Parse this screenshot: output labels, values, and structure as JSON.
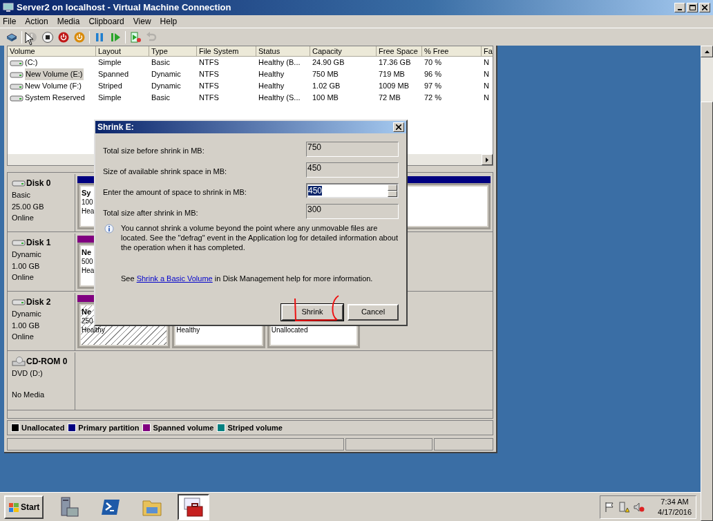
{
  "window": {
    "title": "Server2 on localhost - Virtual Machine Connection"
  },
  "menu": [
    "File",
    "Action",
    "Media",
    "Clipboard",
    "View",
    "Help"
  ],
  "toolbar": [
    {
      "kind": "keys",
      "disabled": false
    },
    {
      "kind": "start",
      "disabled": true
    },
    {
      "kind": "stop",
      "disabled": false
    },
    {
      "kind": "shutdown",
      "disabled": false
    },
    {
      "kind": "save",
      "disabled": false
    },
    {
      "kind": "pause",
      "disabled": false
    },
    {
      "kind": "reset",
      "disabled": false
    },
    {
      "kind": "checkpoint",
      "disabled": false
    },
    {
      "kind": "revert",
      "disabled": true
    }
  ],
  "volume_list": {
    "columns": [
      "Volume",
      "Layout",
      "Type",
      "File System",
      "Status",
      "Capacity",
      "Free Space",
      "% Free",
      "Fa"
    ],
    "rows": [
      {
        "selected": false,
        "cells": [
          "(C:)",
          "Simple",
          "Basic",
          "NTFS",
          "Healthy (B...",
          "24.90 GB",
          "17.36 GB",
          "70 %",
          "N"
        ]
      },
      {
        "selected": true,
        "cells": [
          "New Volume (E:)",
          "Spanned",
          "Dynamic",
          "NTFS",
          "Healthy",
          "750 MB",
          "719 MB",
          "96 %",
          "N"
        ]
      },
      {
        "selected": false,
        "cells": [
          "New Volume (F:)",
          "Striped",
          "Dynamic",
          "NTFS",
          "Healthy",
          "1.02 GB",
          "1009 MB",
          "97 %",
          "N"
        ]
      },
      {
        "selected": false,
        "cells": [
          "System Reserved",
          "Simple",
          "Basic",
          "NTFS",
          "Healthy (S...",
          "100 MB",
          "72 MB",
          "72 %",
          "N"
        ]
      }
    ]
  },
  "disks": [
    {
      "kind": "basic",
      "name": "Disk 0",
      "lines": [
        "Basic",
        "25.00 GB",
        "Online"
      ],
      "partitions": [
        {
          "color": "#000080",
          "selected": false,
          "lines": [
            "Sy",
            "100",
            "Hea"
          ]
        },
        {
          "color": "#000080",
          "selected": false
        }
      ]
    },
    {
      "kind": "dynamic",
      "name": "Disk 1",
      "lines": [
        "Dynamic",
        "1.00 GB",
        "Online"
      ],
      "partitions": [
        {
          "color": "#800080",
          "selected": false,
          "lines": [
            "Ne",
            "500",
            "Hea"
          ]
        }
      ]
    },
    {
      "kind": "dynamic",
      "name": "Disk 2",
      "lines": [
        "Dynamic",
        "1.00 GB",
        "Online"
      ],
      "partitions": [
        {
          "color": "#800080",
          "selected": true,
          "lines": [
            "Ne",
            "250",
            "Healthy"
          ]
        },
        {
          "selected": false,
          "lines": [
            "Healthy"
          ]
        },
        {
          "selected": false,
          "lines": [
            "Unallocated"
          ]
        }
      ]
    },
    {
      "kind": "cdrom",
      "name": "CD-ROM 0",
      "lines": [
        "DVD (D:)",
        "No Media"
      ]
    }
  ],
  "legend": [
    {
      "label": "Unallocated",
      "color": "#000000"
    },
    {
      "label": "Primary partition",
      "color": "#000080"
    },
    {
      "label": "Spanned volume",
      "color": "#800080"
    },
    {
      "label": "Striped volume",
      "color": "#008080"
    }
  ],
  "dialog": {
    "title": "Shrink E:",
    "fields": [
      {
        "kind": "readonly",
        "label": "Total size before shrink in MB:",
        "value": "750"
      },
      {
        "kind": "readonly",
        "label": "Size of available shrink space in MB:",
        "value": "450"
      },
      {
        "kind": "spin",
        "label": "Enter the amount of space to shrink in MB:",
        "value": "450"
      },
      {
        "kind": "readonly",
        "label": "Total size after shrink in MB:",
        "value": "300"
      }
    ],
    "info": "You cannot shrink a volume beyond the point where any unmovable files are located. See the \"defrag\" event in the Application log for detailed information about the operation when it has completed.",
    "help": {
      "before": "See ",
      "link": "Shrink a Basic Volume",
      "after": " in Disk Management help for more information."
    },
    "buttons": [
      {
        "label": "Shrink",
        "default": true
      },
      {
        "label": "Cancel",
        "default": false
      }
    ]
  },
  "taskbar": {
    "start": "Start",
    "apps": [
      {
        "kind": "server",
        "selected": false
      },
      {
        "kind": "console",
        "selected": false
      },
      {
        "kind": "folder",
        "selected": false
      },
      {
        "kind": "toolbox",
        "selected": true
      }
    ],
    "time": "7:34 AM",
    "date": "4/17/2016"
  }
}
